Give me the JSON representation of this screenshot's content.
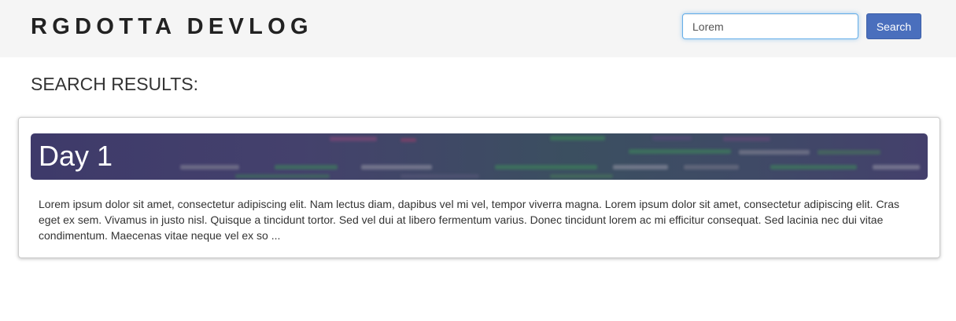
{
  "header": {
    "site_title": "RGDOTTA DEVLOG",
    "search_value": "Lorem",
    "search_button_label": "Search"
  },
  "main": {
    "heading": "SEARCH RESULTS:",
    "results": [
      {
        "title": "Day 1",
        "excerpt": "Lorem ipsum dolor sit amet, consectetur adipiscing elit. Nam lectus diam, dapibus vel mi vel, tempor viverra magna. Lorem ipsum dolor sit amet, consectetur adipiscing elit. Cras eget ex sem. Vivamus in justo nisl. Quisque a tincidunt tortor. Sed vel dui at libero fermentum varius. Donec tincidunt lorem ac mi efficitur consequat. Sed lacinia nec dui vitae condimentum. Maecenas vitae neque vel ex so ..."
      }
    ]
  },
  "colors": {
    "navbar_bg": "#f5f5f5",
    "button_bg": "#4a6fbd",
    "banner_bg": "#42406b",
    "focus_border": "#66afe9"
  }
}
